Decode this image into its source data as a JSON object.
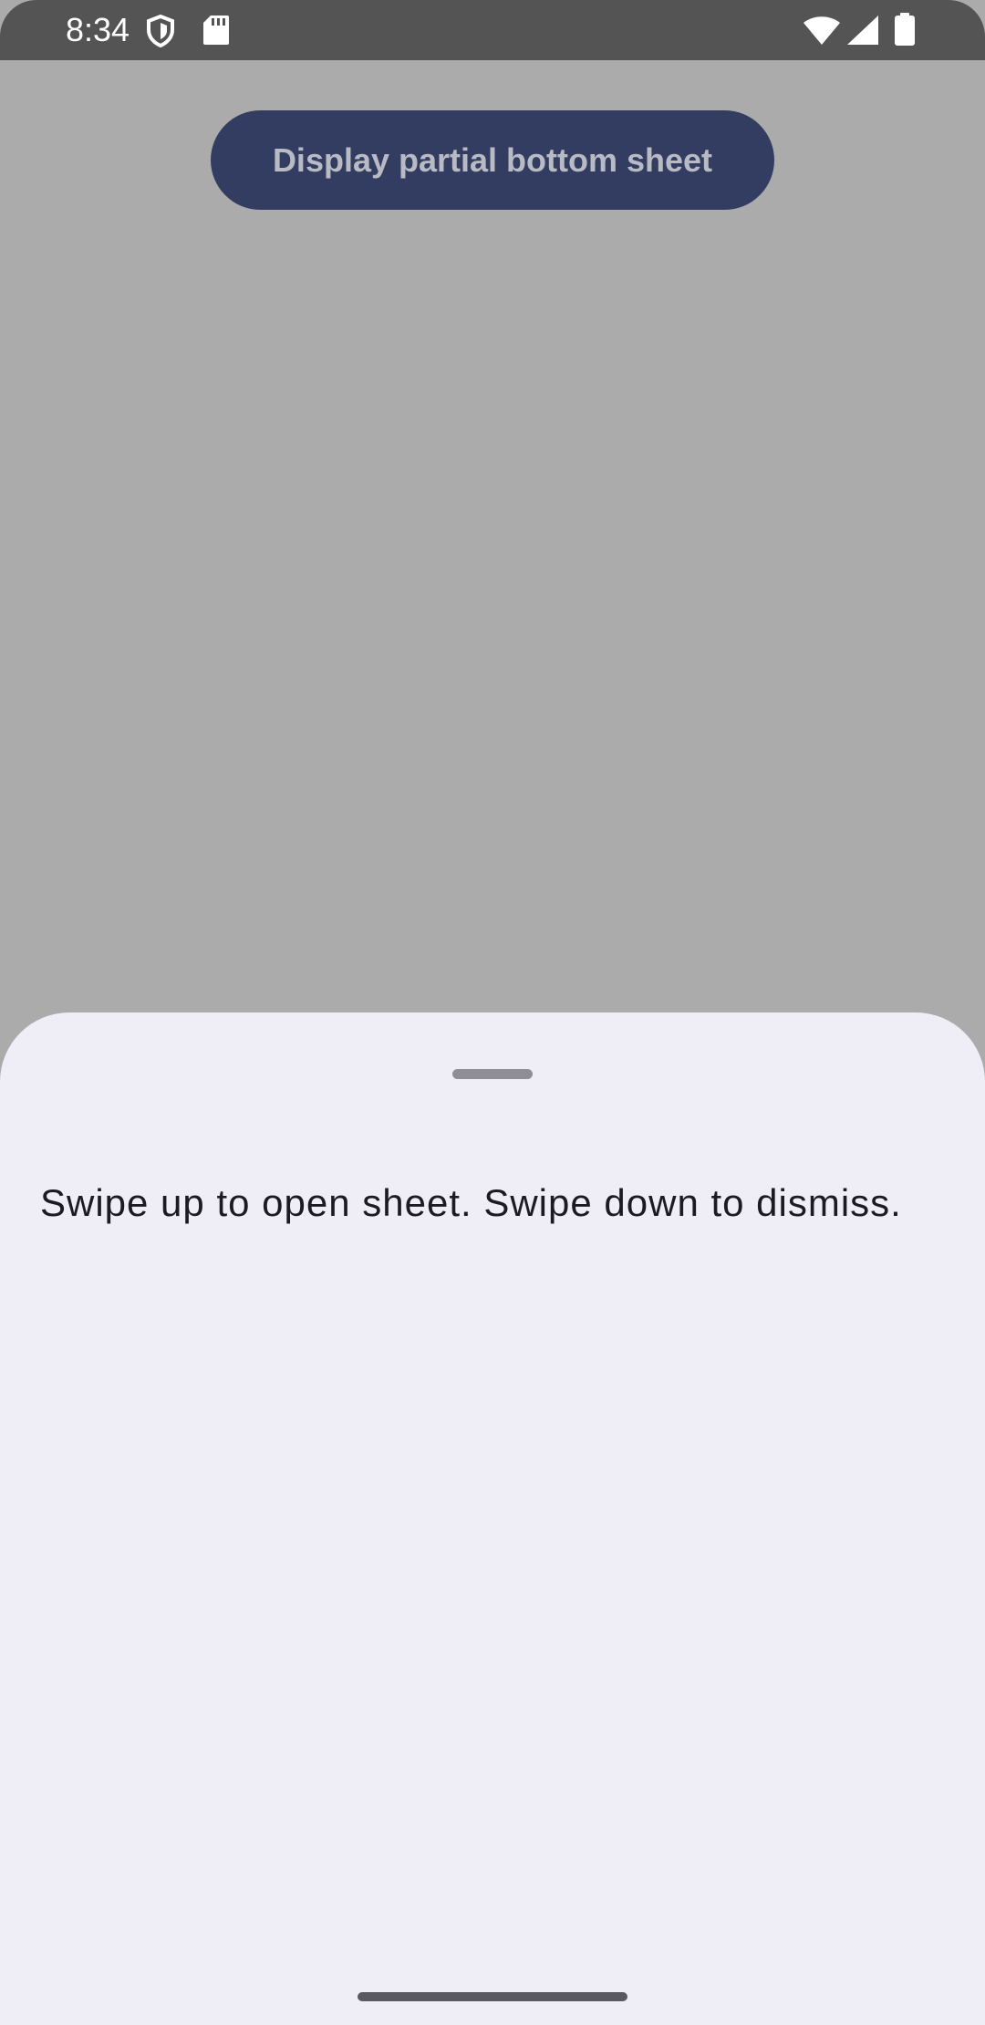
{
  "status_bar": {
    "time": "8:34",
    "icons": [
      "shield-icon",
      "sd-card-icon",
      "wifi-icon",
      "cell-signal-icon",
      "battery-icon"
    ]
  },
  "main": {
    "button_label": "Display partial bottom sheet"
  },
  "bottom_sheet": {
    "text": "Swipe up to open sheet. Swipe down to dismiss."
  },
  "colors": {
    "scrim_background": "#ababab",
    "status_bar": "#545454",
    "button_background": "#333d61",
    "button_text": "#b8bbc4",
    "sheet_background": "#efeef7",
    "sheet_text": "#1c1b21"
  }
}
